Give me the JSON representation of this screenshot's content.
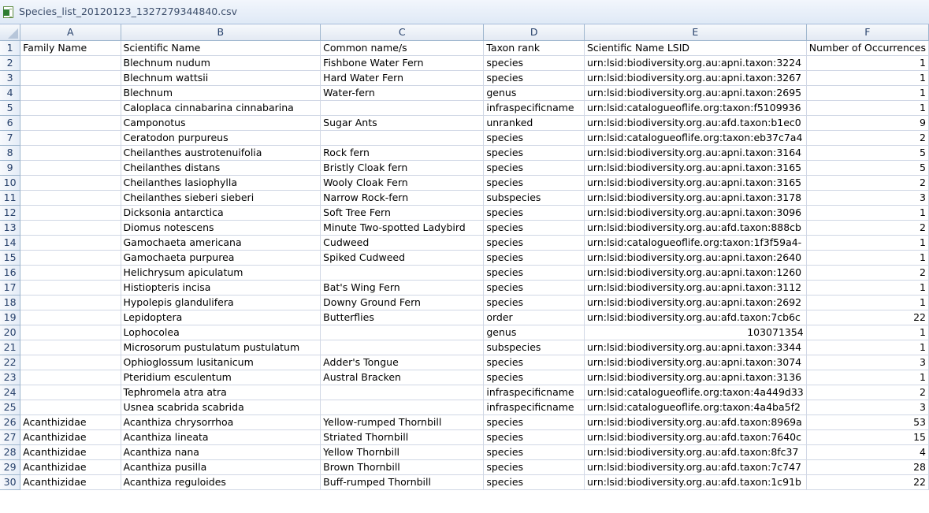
{
  "window": {
    "title": "Species_list_20120123_1327279344840.csv",
    "icon": "excel-csv-icon"
  },
  "columns": [
    "A",
    "B",
    "C",
    "D",
    "E",
    "F"
  ],
  "rows": [
    [
      "1",
      "Family Name",
      "Scientific Name",
      "Common name/s",
      "Taxon rank",
      "Scientific Name LSID",
      "Number of Occurrences"
    ],
    [
      "2",
      "",
      "Blechnum nudum",
      "Fishbone Water Fern",
      "species",
      "urn:lsid:biodiversity.org.au:apni.taxon:3224",
      "1"
    ],
    [
      "3",
      "",
      "Blechnum wattsii",
      "Hard Water Fern",
      "species",
      "urn:lsid:biodiversity.org.au:apni.taxon:3267",
      "1"
    ],
    [
      "4",
      "",
      "Blechnum",
      "Water-fern",
      "genus",
      "urn:lsid:biodiversity.org.au:apni.taxon:2695",
      "1"
    ],
    [
      "5",
      "",
      "Caloplaca cinnabarina cinnabarina",
      "",
      "infraspecificname",
      "urn:lsid:catalogueoflife.org:taxon:f5109936",
      "1"
    ],
    [
      "6",
      "",
      "Camponotus",
      "Sugar Ants",
      "unranked",
      "urn:lsid:biodiversity.org.au:afd.taxon:b1ec0",
      "9"
    ],
    [
      "7",
      "",
      "Ceratodon purpureus",
      "",
      "species",
      "urn:lsid:catalogueoflife.org:taxon:eb37c7a4",
      "2"
    ],
    [
      "8",
      "",
      "Cheilanthes austrotenuifolia",
      "Rock fern",
      "species",
      "urn:lsid:biodiversity.org.au:apni.taxon:3164",
      "5"
    ],
    [
      "9",
      "",
      "Cheilanthes distans",
      "Bristly Cloak fern",
      "species",
      "urn:lsid:biodiversity.org.au:apni.taxon:3165",
      "5"
    ],
    [
      "10",
      "",
      "Cheilanthes lasiophylla",
      "Wooly Cloak Fern",
      "species",
      "urn:lsid:biodiversity.org.au:apni.taxon:3165",
      "2"
    ],
    [
      "11",
      "",
      "Cheilanthes sieberi sieberi",
      "Narrow Rock-fern",
      "subspecies",
      "urn:lsid:biodiversity.org.au:apni.taxon:3178",
      "3"
    ],
    [
      "12",
      "",
      "Dicksonia antarctica",
      "Soft Tree Fern",
      "species",
      "urn:lsid:biodiversity.org.au:apni.taxon:3096",
      "1"
    ],
    [
      "13",
      "",
      "Diomus notescens",
      "Minute Two-spotted Ladybird",
      "species",
      "urn:lsid:biodiversity.org.au:afd.taxon:888cb",
      "2"
    ],
    [
      "14",
      "",
      "Gamochaeta americana",
      "Cudweed",
      "species",
      "urn:lsid:catalogueoflife.org:taxon:1f3f59a4-",
      "1"
    ],
    [
      "15",
      "",
      "Gamochaeta purpurea",
      "Spiked Cudweed",
      "species",
      "urn:lsid:biodiversity.org.au:apni.taxon:2640",
      "1"
    ],
    [
      "16",
      "",
      "Helichrysum apiculatum",
      "",
      "species",
      "urn:lsid:biodiversity.org.au:apni.taxon:1260",
      "2"
    ],
    [
      "17",
      "",
      "Histiopteris incisa",
      "Bat's Wing Fern",
      "species",
      "urn:lsid:biodiversity.org.au:apni.taxon:3112",
      "1"
    ],
    [
      "18",
      "",
      "Hypolepis glandulifera",
      "Downy Ground Fern",
      "species",
      "urn:lsid:biodiversity.org.au:apni.taxon:2692",
      "1"
    ],
    [
      "19",
      "",
      "Lepidoptera",
      "Butterflies",
      "order",
      "urn:lsid:biodiversity.org.au:afd.taxon:7cb6c",
      "22"
    ],
    [
      "20",
      "",
      "Lophocolea",
      "",
      "genus",
      "103071354",
      "1"
    ],
    [
      "21",
      "",
      "Microsorum pustulatum pustulatum",
      "",
      "subspecies",
      "urn:lsid:biodiversity.org.au:apni.taxon:3344",
      "1"
    ],
    [
      "22",
      "",
      "Ophioglossum lusitanicum",
      "Adder's Tongue",
      "species",
      "urn:lsid:biodiversity.org.au:apni.taxon:3074",
      "3"
    ],
    [
      "23",
      "",
      "Pteridium esculentum",
      "Austral Bracken",
      "species",
      "urn:lsid:biodiversity.org.au:apni.taxon:3136",
      "1"
    ],
    [
      "24",
      "",
      "Tephromela atra atra",
      "",
      "infraspecificname",
      "urn:lsid:catalogueoflife.org:taxon:4a449d33",
      "2"
    ],
    [
      "25",
      "",
      "Usnea scabrida scabrida",
      "",
      "infraspecificname",
      "urn:lsid:catalogueoflife.org:taxon:4a4ba5f2",
      "3"
    ],
    [
      "26",
      "Acanthizidae",
      "Acanthiza chrysorrhoa",
      "Yellow-rumped Thornbill",
      "species",
      "urn:lsid:biodiversity.org.au:afd.taxon:8969a",
      "53"
    ],
    [
      "27",
      "Acanthizidae",
      "Acanthiza lineata",
      "Striated Thornbill",
      "species",
      "urn:lsid:biodiversity.org.au:afd.taxon:7640c",
      "15"
    ],
    [
      "28",
      "Acanthizidae",
      "Acanthiza nana",
      "Yellow Thornbill",
      "species",
      "urn:lsid:biodiversity.org.au:afd.taxon:8fc37",
      "4"
    ],
    [
      "29",
      "Acanthizidae",
      "Acanthiza pusilla",
      "Brown Thornbill",
      "species",
      "urn:lsid:biodiversity.org.au:afd.taxon:7c747",
      "28"
    ],
    [
      "30",
      "Acanthizidae",
      "Acanthiza reguloides",
      "Buff-rumped Thornbill",
      "species",
      "urn:lsid:biodiversity.org.au:afd.taxon:1c91b",
      "22"
    ]
  ]
}
